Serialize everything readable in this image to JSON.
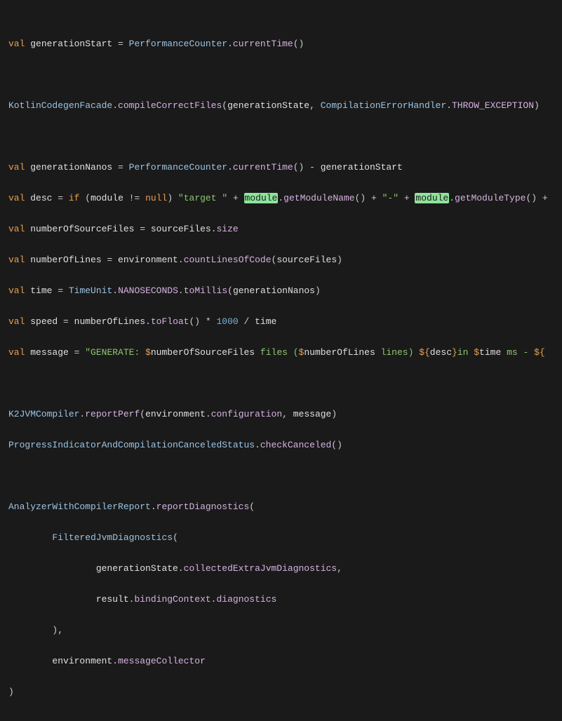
{
  "code": {
    "l1_val": "val",
    "l1_name": "generationStart",
    "l1_eq": " = ",
    "l1_type": "PerformanceCounter",
    "l1_dot": ".",
    "l1_method": "currentTime",
    "l1_paren": "()",
    "l3_type": "KotlinCodegenFacade",
    "l3_dot": ".",
    "l3_method": "compileCorrectFiles",
    "l3_open": "(",
    "l3_arg1": "generationState",
    "l3_comma": ", ",
    "l3_arg2": "CompilationErrorHandler",
    "l3_dot2": ".",
    "l3_prop": "THROW_EXCEPTION",
    "l3_close": ")",
    "l5_val": "val",
    "l5_name": "generationNanos",
    "l5_eq": " = ",
    "l5_type": "PerformanceCounter",
    "l5_dot": ".",
    "l5_method": "currentTime",
    "l5_paren": "()",
    "l5_minus": " - ",
    "l5_rhs": "generationStart",
    "l6_val": "val",
    "l6_name": "desc",
    "l6_eq": " = ",
    "l6_if": "if",
    "l6_open": " (",
    "l6_mod": "module",
    "l6_ne": " != ",
    "l6_null": "null",
    "l6_close": ") ",
    "l6_s1": "\"target \"",
    "l6_plus1": " + ",
    "l6_hl1": "module",
    "l6_dot1": ".",
    "l6_m1": "getModuleName",
    "l6_p1": "()",
    "l6_plus2": " + ",
    "l6_s2": "\"-\"",
    "l6_plus3": " + ",
    "l6_hl2": "module",
    "l6_dot2": ".",
    "l6_m2": "getModuleType",
    "l6_p2": "()",
    "l6_plus4": " + ",
    "l7_val": "val",
    "l7_name": "numberOfSourceFiles",
    "l7_eq": " = ",
    "l7_rhs": "sourceFiles",
    "l7_dot": ".",
    "l7_prop": "size",
    "l8_val": "val",
    "l8_name": "numberOfLines",
    "l8_eq": " = ",
    "l8_rhs": "environment",
    "l8_dot": ".",
    "l8_method": "countLinesOfCode",
    "l8_open": "(",
    "l8_arg": "sourceFiles",
    "l8_close": ")",
    "l9_val": "val",
    "l9_name": "time",
    "l9_eq": " = ",
    "l9_type": "TimeUnit",
    "l9_dot": ".",
    "l9_prop": "NANOSECONDS",
    "l9_dot2": ".",
    "l9_method": "toMillis",
    "l9_open": "(",
    "l9_arg": "generationNanos",
    "l9_close": ")",
    "l10_val": "val",
    "l10_name": "speed",
    "l10_eq": " = ",
    "l10_a": "numberOfLines",
    "l10_dot": ".",
    "l10_method": "toFloat",
    "l10_paren": "()",
    "l10_times": " * ",
    "l10_num": "1000",
    "l10_div": " / ",
    "l10_b": "time",
    "l11_val": "val",
    "l11_name": "message",
    "l11_eq": " = ",
    "l11_q1": "\"GENERATE: ",
    "l11_d1": "$",
    "l11_v1": "numberOfSourceFiles",
    "l11_s2": " files (",
    "l11_d2": "$",
    "l11_v2": "numberOfLines",
    "l11_s3": " lines) ",
    "l11_d3": "${",
    "l11_v3": "desc",
    "l11_cb": "}",
    "l11_s4": "in ",
    "l11_d4": "$",
    "l11_v4": "time",
    "l11_s5": " ms - ",
    "l11_d5": "${",
    "l13_type": "K2JVMCompiler",
    "l13_dot": ".",
    "l13_method": "reportPerf",
    "l13_open": "(",
    "l13_a": "environment",
    "l13_dot2": ".",
    "l13_prop": "configuration",
    "l13_comma": ", ",
    "l13_b": "message",
    "l13_close": ")",
    "l14_type": "ProgressIndicatorAndCompilationCanceledStatus",
    "l14_dot": ".",
    "l14_method": "checkCanceled",
    "l14_paren": "()",
    "l16_type": "AnalyzerWithCompilerReport",
    "l16_dot": ".",
    "l16_method": "reportDiagnostics",
    "l16_open": "(",
    "l17_indent": "        ",
    "l17_type": "FilteredJvmDiagnostics",
    "l17_open": "(",
    "l18_indent": "                ",
    "l18_a": "generationState",
    "l18_dot": ".",
    "l18_prop": "collectedExtraJvmDiagnostics",
    "l18_comma": ",",
    "l19_indent": "                ",
    "l19_a": "result",
    "l19_dot": ".",
    "l19_prop": "bindingContext",
    "l19_dot2": ".",
    "l19_prop2": "diagnostics",
    "l20_indent": "        ",
    "l20_close": "),",
    "l21_indent": "        ",
    "l21_a": "environment",
    "l21_dot": ".",
    "l21_prop": "messageCollector",
    "l22_close": ")"
  }
}
